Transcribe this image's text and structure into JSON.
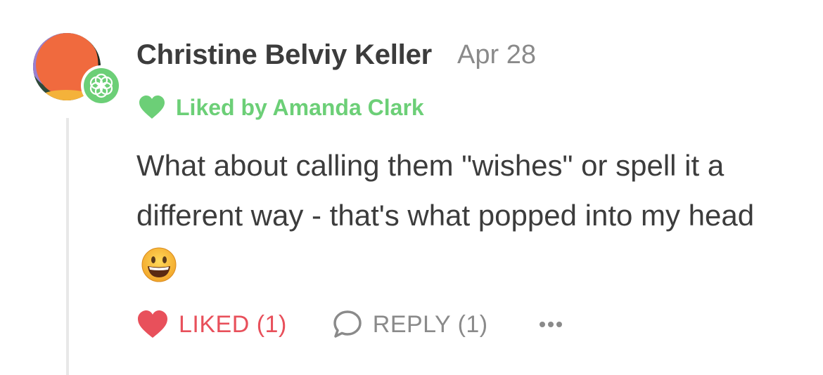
{
  "comment": {
    "author": "Christine Belviy Keller",
    "date": "Apr 28",
    "liked_by": "Liked by Amanda Clark",
    "text": "What about calling them \"wishes\" or spell it a different way - that's what popped into my head",
    "emoji": "grinning-face"
  },
  "actions": {
    "like_label": "LIKED (1)",
    "reply_label": "REPLY (1)",
    "more_icon": "more-icon"
  },
  "colors": {
    "liked_by_green": "#6ccf77",
    "liked_red": "#e8505b",
    "muted_gray": "#8a8a8a"
  }
}
